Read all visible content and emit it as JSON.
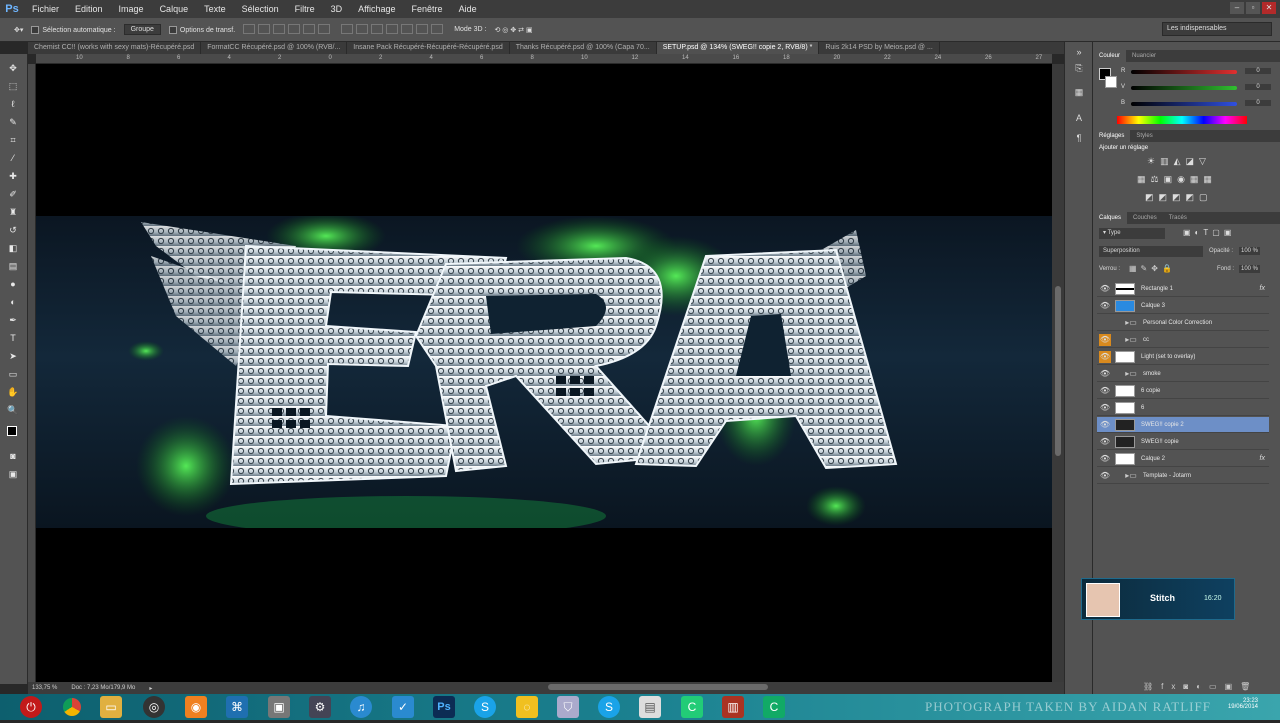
{
  "menu": {
    "logo": "Ps",
    "items": [
      "Fichier",
      "Edition",
      "Image",
      "Calque",
      "Texte",
      "Sélection",
      "Filtre",
      "3D",
      "Affichage",
      "Fenêtre",
      "Aide"
    ]
  },
  "options": {
    "auto_select_label": "Sélection automatique :",
    "auto_select_value": "Groupe",
    "transform_label": "Options de transf.",
    "mode3d_label": "Mode 3D :",
    "workspace": "Les indispensables"
  },
  "tabs": [
    "Chemist CC!! (works with sexy mats)-Récupéré.psd",
    "FormatCC Récupéré.psd @ 100% (RVB/...",
    "Insane Pack Récupéré-Récupéré-Récupéré.psd",
    "Thanks Récupéré.psd @ 100% (Capa 70...",
    "SETUP.psd @ 134% (SWEG!! copie 2, RVB/8) *",
    "Ruis 2k14 PSD by Meios.psd @ ..."
  ],
  "active_tab": 4,
  "ruler_ticks": [
    "10",
    "8",
    "6",
    "4",
    "2",
    "0",
    "2",
    "4",
    "6",
    "8",
    "10",
    "12",
    "14",
    "16",
    "18",
    "20",
    "22",
    "24",
    "26",
    "27",
    "29"
  ],
  "status": {
    "zoom": "133,75 %",
    "doc": "Doc : 7,23 Mo/179,9 Mo"
  },
  "color_panel": {
    "tabs": [
      "Couleur",
      "Nuancier"
    ],
    "channels": [
      {
        "label": "R",
        "value": "0"
      },
      {
        "label": "V",
        "value": "0"
      },
      {
        "label": "B",
        "value": "0"
      }
    ],
    "colors": {
      "r": "#e03030",
      "g": "#30c030",
      "b": "#3050e0"
    }
  },
  "adjust_panel": {
    "tabs": [
      "Réglages",
      "Styles"
    ],
    "title": "Ajouter un réglage"
  },
  "layers_panel": {
    "tabs": [
      "Calques",
      "Couches",
      "Tracés"
    ],
    "filter": "Type",
    "blend": "Superposition",
    "opacity_label": "Opacité :",
    "opacity": "100 %",
    "lock_label": "Verrou :",
    "fill_label": "Fond :",
    "fill": "100 %",
    "layers": [
      {
        "name": "Rectangle 1",
        "kind": "thumb",
        "fx": true,
        "eye": "normal"
      },
      {
        "name": "Calque 3",
        "kind": "blue",
        "fx": false,
        "eye": "normal"
      },
      {
        "name": "Personal Color Correction",
        "kind": "folder",
        "fx": false,
        "eye": "none"
      },
      {
        "name": "cc",
        "kind": "folder",
        "fx": false,
        "eye": "orange"
      },
      {
        "name": "Light (set to overlay)",
        "kind": "thumb",
        "fx": false,
        "eye": "orange"
      },
      {
        "name": "smoke",
        "kind": "folder",
        "fx": false,
        "eye": "normal"
      },
      {
        "name": "6 copie",
        "kind": "thumb",
        "fx": false,
        "eye": "normal"
      },
      {
        "name": "6",
        "kind": "thumb",
        "fx": false,
        "eye": "normal"
      },
      {
        "name": "SWEG!! copie 2",
        "kind": "dark",
        "fx": false,
        "eye": "normal",
        "selected": true
      },
      {
        "name": "SWEG!! copie",
        "kind": "dark",
        "fx": false,
        "eye": "normal"
      },
      {
        "name": "Calque 2",
        "kind": "thumb",
        "fx": true,
        "eye": "normal"
      },
      {
        "name": "Template - Jotarm",
        "kind": "folder",
        "fx": false,
        "eye": "normal"
      }
    ]
  },
  "notification": {
    "name": "Stitch",
    "time": "16:20"
  },
  "taskbar": {
    "watermark": "PHOTOGRAPH TAKEN BY AIDAN RATLIFF",
    "time": "23:23",
    "date": "19/06/2014"
  }
}
